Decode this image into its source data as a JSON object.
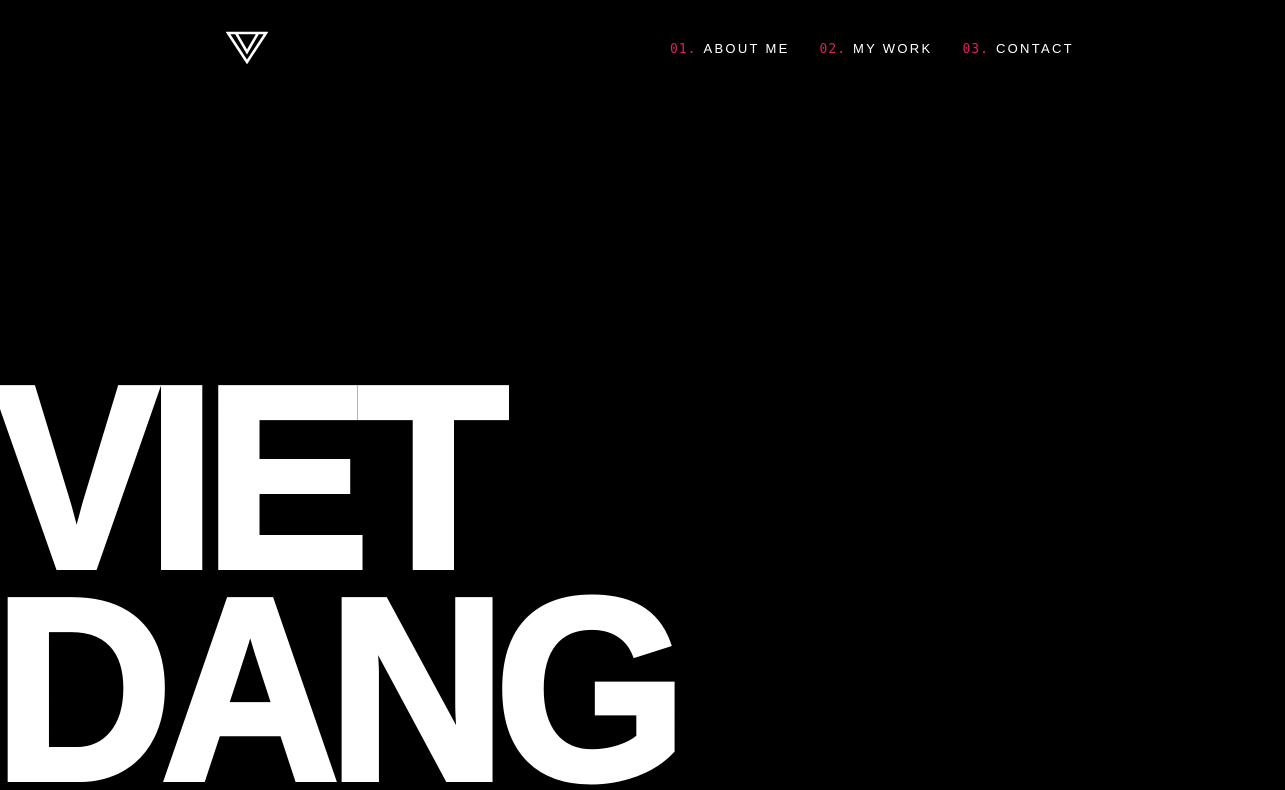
{
  "logo": {
    "icon": "v-monogram-icon",
    "color": "#ffffff"
  },
  "nav": {
    "accent_color": "#e6196a",
    "items": [
      {
        "number": "01.",
        "label": "ABOUT ME"
      },
      {
        "number": "02.",
        "label": "MY WORK"
      },
      {
        "number": "03.",
        "label": "CONTACT"
      }
    ]
  },
  "hero": {
    "line1": "VIET",
    "line2": "DANG"
  },
  "colors": {
    "background": "#000000",
    "text": "#ffffff",
    "accent": "#e6196a"
  }
}
